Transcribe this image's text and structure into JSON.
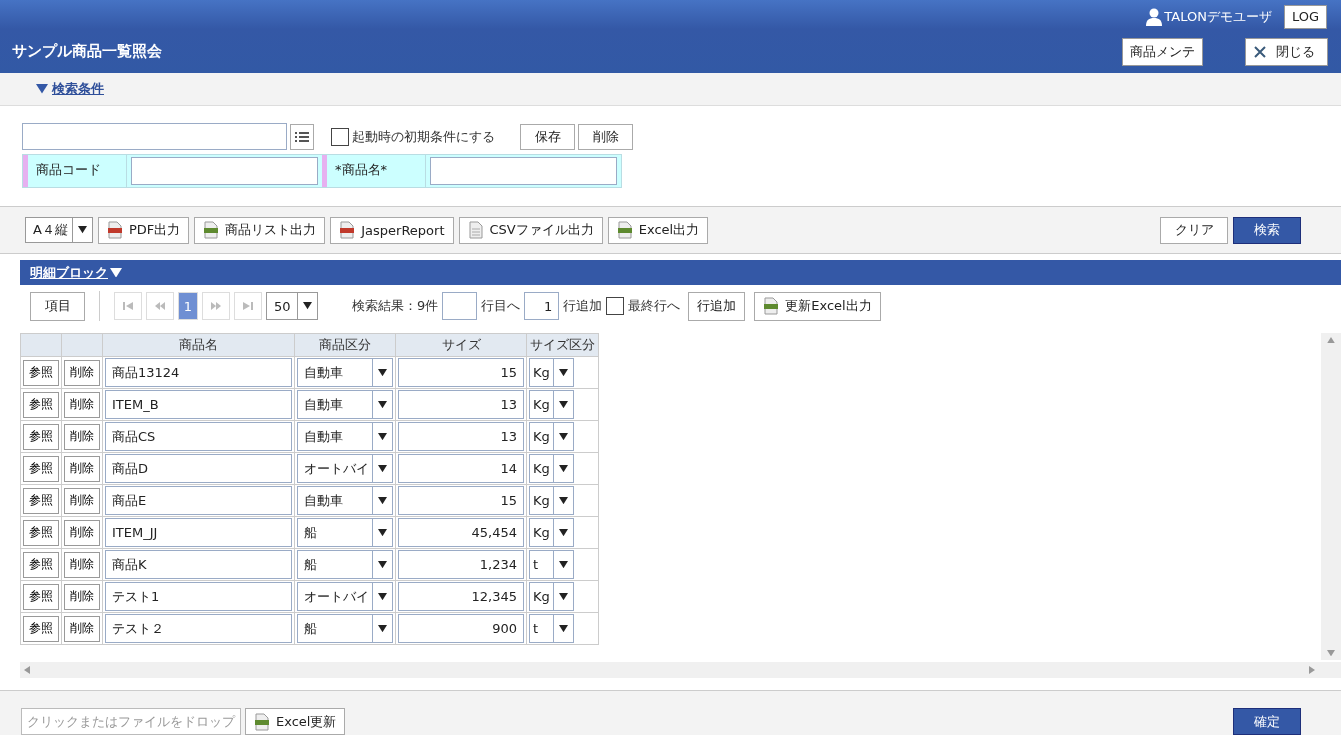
{
  "header": {
    "user": "TALONデモユーザ",
    "log_button": "LOG",
    "title": "サンプル商品一覧照会",
    "buttons": [
      {
        "label": "商品メンテ",
        "kind": "plain"
      },
      {
        "label": "閉じる",
        "kind": "close"
      }
    ]
  },
  "search": {
    "toggle": "検索条件",
    "expanded": true,
    "checkbox": {
      "label": "起動時の初期条件にする",
      "checked": false
    },
    "buttons": [
      "保存",
      "削除"
    ],
    "fields": [
      {
        "label": "商品コード"
      },
      {
        "label": "*商品名*"
      }
    ]
  },
  "toolbar": {
    "paper_select": "A４縦",
    "export_buttons": [
      {
        "label": "PDF出力",
        "kind": "pdf"
      },
      {
        "label": "商品リスト出力",
        "kind": "excel"
      },
      {
        "label": "JasperReport",
        "kind": "pdf"
      },
      {
        "label": "CSVファイル出力",
        "kind": "doc"
      },
      {
        "label": "Excel出力",
        "kind": "excel"
      }
    ],
    "right_buttons": [
      {
        "label": "クリア",
        "kind": "plain"
      },
      {
        "label": "検索",
        "kind": "primary"
      }
    ]
  },
  "detail": {
    "title": "明細ブロック",
    "expanded": true,
    "columns_button": "項目",
    "current_page": "1",
    "page_size": "50",
    "result": "検索結果：9件",
    "goto_suffix": "行目へ",
    "add_count": "1",
    "add_suffix": "行追加",
    "last_row": {
      "label": "最終行へ",
      "checked": false
    },
    "add_button": "行追加",
    "excel_button": "更新Excel出力",
    "columns": [
      "商品名",
      "商品区分",
      "サイズ",
      "サイズ区分"
    ],
    "rows": [
      {
        "ref": "参照",
        "del": "削除",
        "name": "商品13124",
        "category": "自動車",
        "size": "15",
        "unit": "Kg"
      },
      {
        "ref": "参照",
        "del": "削除",
        "name": "ITEM_B",
        "category": "自動車",
        "size": "13",
        "unit": "Kg"
      },
      {
        "ref": "参照",
        "del": "削除",
        "name": "商品CS",
        "category": "自動車",
        "size": "13",
        "unit": "Kg"
      },
      {
        "ref": "参照",
        "del": "削除",
        "name": "商品D",
        "category": "オートバイ",
        "size": "14",
        "unit": "Kg"
      },
      {
        "ref": "参照",
        "del": "削除",
        "name": "商品E",
        "category": "自動車",
        "size": "15",
        "unit": "Kg"
      },
      {
        "ref": "参照",
        "del": "削除",
        "name": "ITEM_JJ",
        "category": "船",
        "size": "45,454",
        "unit": "Kg"
      },
      {
        "ref": "参照",
        "del": "削除",
        "name": "商品K",
        "category": "船",
        "size": "1,234",
        "unit": "t"
      },
      {
        "ref": "参照",
        "del": "削除",
        "name": "テスト1",
        "category": "オートバイ",
        "size": "12,345",
        "unit": "Kg"
      },
      {
        "ref": "参照",
        "del": "削除",
        "name": "テスト２",
        "category": "船",
        "size": "900",
        "unit": "t"
      }
    ]
  },
  "footer": {
    "drop_placeholder": "クリックまたはファイルをドロップ",
    "excel_update": "Excel更新",
    "confirm": "確定"
  }
}
